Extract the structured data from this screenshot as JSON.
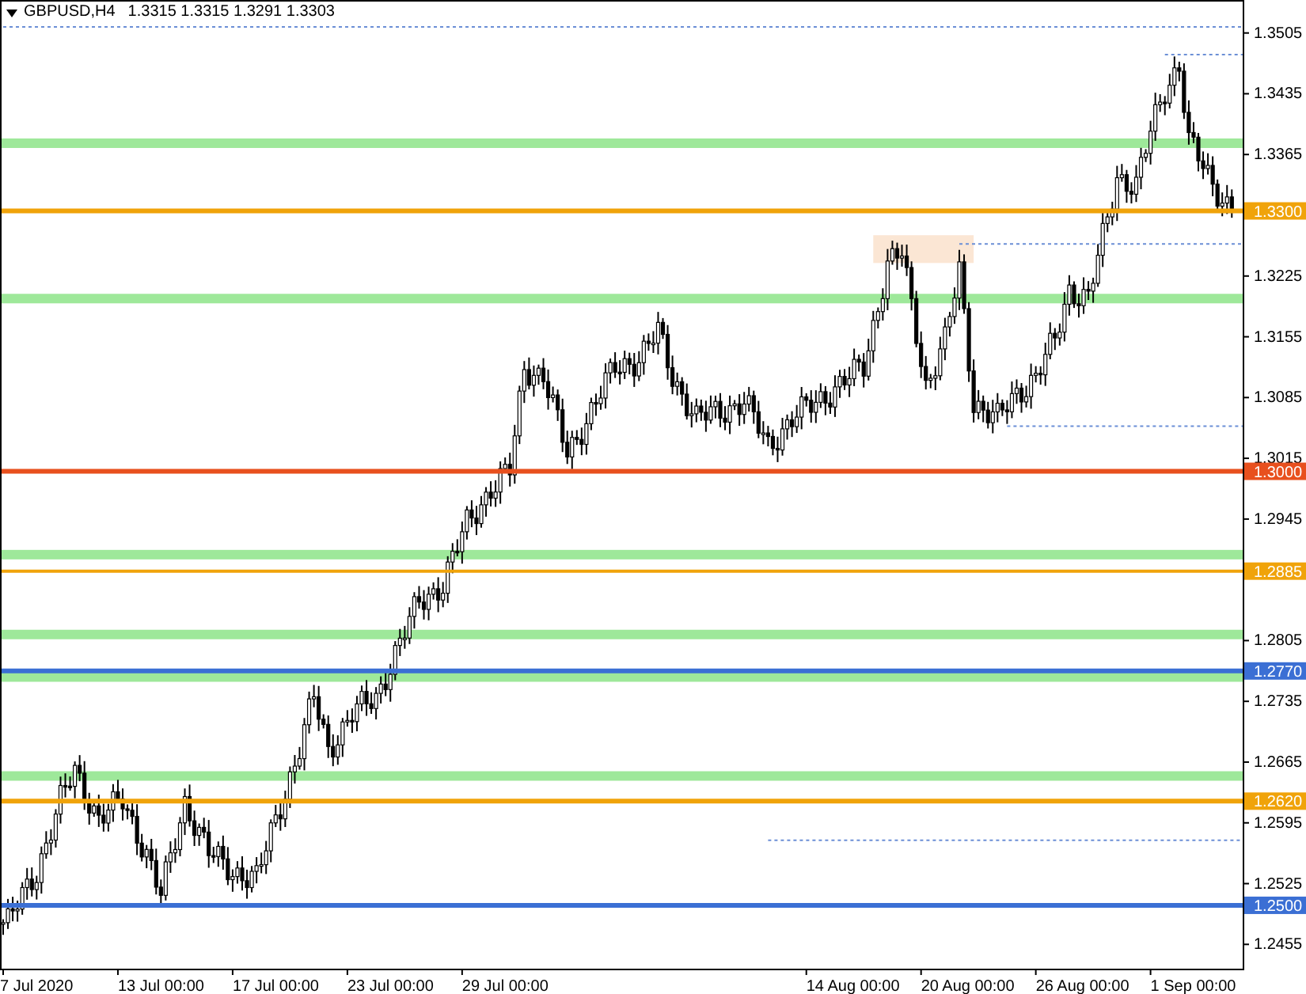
{
  "header": {
    "symbol": "GBPUSD,H4",
    "quote": "1.3315 1.3315 1.3291 1.3303"
  },
  "price_axis": {
    "labels": [
      "1.3505",
      "1.3435",
      "1.3365",
      "1.3225",
      "1.3155",
      "1.3085",
      "1.3015",
      "1.2945",
      "1.2805",
      "1.2735",
      "1.2665",
      "1.2595",
      "1.2525",
      "1.2455"
    ]
  },
  "levels": [
    {
      "label": "1.3300",
      "color": "#f0a30a"
    },
    {
      "label": "1.3000",
      "color": "#e8501e"
    },
    {
      "label": "1.2885",
      "color": "#f0a30a"
    },
    {
      "label": "1.2770",
      "color": "#3b6fd4"
    },
    {
      "label": "1.2620",
      "color": "#f0a30a"
    },
    {
      "label": "1.2500",
      "color": "#3b6fd4"
    }
  ],
  "time_axis": {
    "labels": [
      "7 Jul 2020",
      "13 Jul 00:00",
      "17 Jul 00:00",
      "23 Jul 00:00",
      "29 Jul 00:00",
      "14 Aug 00:00",
      "20 Aug 00:00",
      "26 Aug 00:00",
      "1 Sep 00:00"
    ]
  }
}
